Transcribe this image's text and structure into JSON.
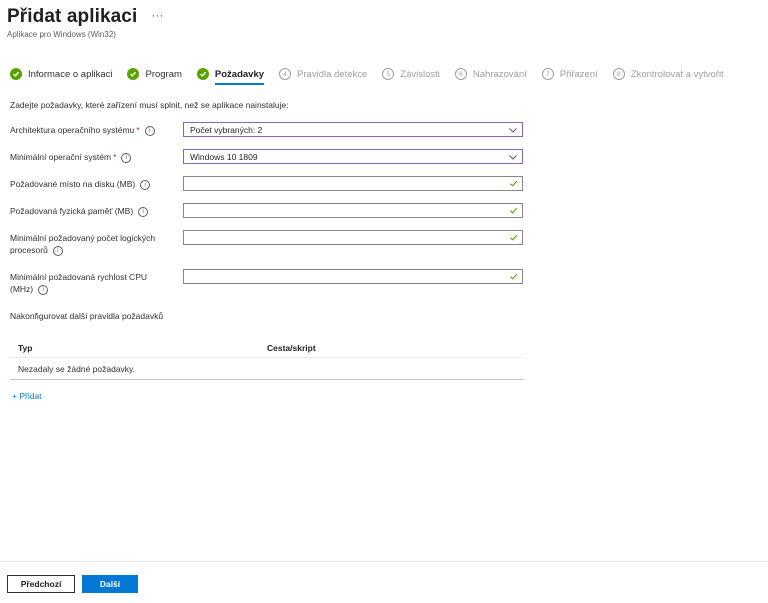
{
  "header": {
    "title": "Přidat aplikaci",
    "more": "···",
    "subtitle": "Aplikace pro Windows (Win32)"
  },
  "steps": [
    {
      "label": "Informace o aplikaci",
      "state": "done"
    },
    {
      "label": "Program",
      "state": "done"
    },
    {
      "label": "Požadavky",
      "state": "current"
    },
    {
      "num": "4",
      "label": "Pravidla detekce",
      "state": "pending"
    },
    {
      "num": "5",
      "label": "Závislosti",
      "state": "pending"
    },
    {
      "num": "6",
      "label": "Nahrazování",
      "state": "pending"
    },
    {
      "num": "7",
      "label": "Přiřazení",
      "state": "pending"
    },
    {
      "num": "8",
      "label": "Zkontrolovat a vytvořit",
      "state": "pending"
    }
  ],
  "intro": "Zadejte požadavky, které zařízení musí splnit, než se aplikace nainstaluje:",
  "form": {
    "os_arch": {
      "label": "Architektura operačního systému",
      "required": "*",
      "value": "Počet vybraných: 2"
    },
    "min_os": {
      "label": "Minimální operační systém",
      "required": "*",
      "value": "Windows 10 1809"
    },
    "disk": {
      "label": "Požadované místo na disku (MB)",
      "value": ""
    },
    "ram": {
      "label": "Požadovaná fyzická paměť (MB)",
      "value": ""
    },
    "cpu_count": {
      "label_line1": "Minimální požadovaný počet logických",
      "label_line2": "procesorů",
      "value": ""
    },
    "cpu_speed": {
      "label_line1": "Minimální požadovaná rychlost CPU",
      "label_line2": "(MHz)",
      "value": ""
    }
  },
  "info_glyph": "i",
  "rules": {
    "title": "Nakonfigurovat další pravidla požadavků",
    "columns": [
      "Typ",
      "Cesta/skript"
    ],
    "empty": "Nezadaly se žádné požadavky.",
    "add": "+ Přidat"
  },
  "footer": {
    "prev": "Předchozí",
    "next": "Další"
  },
  "colors": {
    "accent": "#0078d4",
    "success": "#57a300",
    "focus_border": "#8764b8",
    "required": "#a4262c"
  }
}
